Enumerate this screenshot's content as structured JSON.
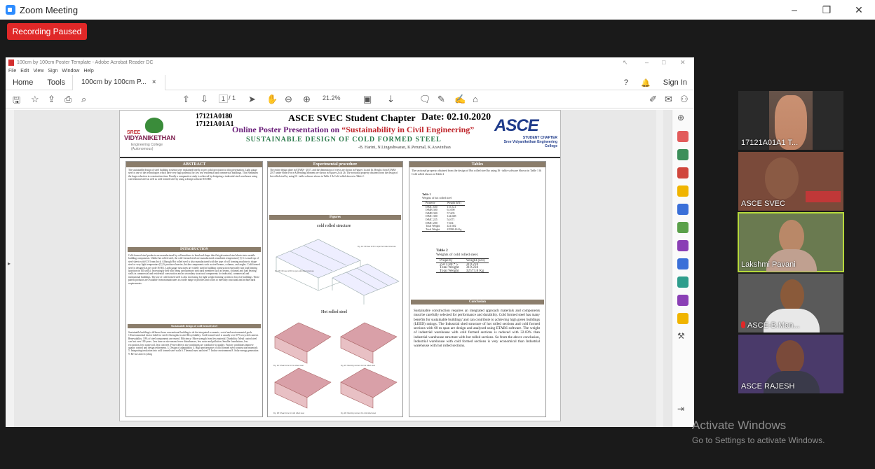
{
  "zoom": {
    "window_title": "Zoom Meeting",
    "recording_status": "Recording Paused",
    "controls": {
      "minimize": "–",
      "restore": "❐",
      "close": "✕"
    }
  },
  "acrobat": {
    "window_title": "100cm by 100cm Poster Template - Adobe Acrobat Reader DC",
    "menu": [
      "File",
      "Edit",
      "View",
      "Sign",
      "Window",
      "Help"
    ],
    "tabs": {
      "home": "Home",
      "tools": "Tools",
      "document": "100cm by 100cm P...",
      "close": "×"
    },
    "sign_in": "Sign In",
    "page_current": "1",
    "page_total": "/ 1",
    "zoom_level": "21.2%"
  },
  "poster": {
    "id1": "17121A0180",
    "id2": "17121A01A1",
    "chapter": "ASCE SVEC Student Chapter",
    "date": "Date: 02.10.2020",
    "presentation_prefix": "Online Poster Presentation on",
    "presentation_theme": "“Sustainability in Civil Engineering”",
    "design_title": "SUSTAINABLE DESIGN OF COLD FORMED STEEL",
    "authors": "-B. Harini, N.Lingeshwaran, K.Perumal, K.Aravinthan",
    "logo_left": {
      "line1": "SREE",
      "line2": "VIDYANIKETHAN",
      "line3": "Engineering College (Autonomous)"
    },
    "logo_right": {
      "big": "ASCE",
      "sub1": "STUDENT CHAPTER",
      "sub2": "Sree Vidyanikethan Engineering College"
    },
    "col1": {
      "abstract_h": "ABSTRACT",
      "abstract": "The sustainable design of steel building systems were explained briefly as per codal provisions in this presentation. Light gauge steel is one of the technologies which have very high potential for low rise residential and commercial buildings. This eliminates the huge reduction in construction time. Finally a comparative study is achieved by designing a industrial steel warehouse using conventional steel as well as cold formed steel by using a design software ETABS.",
      "intro_h": "INTRODUCTION",
      "intro": "Cold-formed steel products are manufactured by roll machines to bend and shape thin flat galvanized steel sheets into useable building components. Unlike hot rolled steel, the cold-formed steel are manufactured at ambient temperature [1]. It is made up of steel sheets with 0.3-3 mm thick. Although Hot rolled steel is also manufactured with the type of roll forming machine to shape steel or very light temperature [2]. It produces heavier, thicker components such as steel beams, columns, and angles. Cold formed steel is designed as per code IS 801. Light gauge structures are widely used in building construction especially non load bearing (partition in fill walls). Increasingly they also being used primary structural members such as beams, columns and load bearing walls in commercial and residential construction and as secondary structural components for industrial, commercial and institutional buildings. The use of cold formed steel is also increasing for light weight framing system in low rise buildings. These panels products are available from manufactures in a wide range of profiles and colors to meet any structural and architectural requirements.",
      "sust_h": "Sustainable design of cold formed steel",
      "sust": "Sustainable building is different from conventional building to do the integrated economic, social and environmental goals. 1.Environmental choice label for steel 2.Strengths in steel Recyclability: Cold formed steel is usually over 67% recycled content. Renewability: 10% of steel components are reused. Efficiency: More strength from less material. Durability: Metal coated steel can last over 100 years. Less time on site means fewer disturbances, less noise and pollution. Smaller foundations, less excavation, less waste soil, less concrete. Fewer defects site conditions are conducive to quality. Factory conditions improve quality control and design refinement. 3. Design of adaptability 4. High performance of cold formed steel construction materials 5. Integrating insulation into cold formed steel walls 6. Thermal mass and steel 7. Indoor environment 8. Solar energy generation 9. Re-use and recycling"
    },
    "col2": {
      "exp_h": "Experimental procedure",
      "exp": "The entire design done in ETABS - 2017, and the dimensions of views are shown in Figures 1a and 1b. Results from ETABS 2017 under Shear Force & Bending Moment are shown in Figures 2a & 2b. The sectional property obtained from the design of hot rolled steel by using IS - table software shown in Table 1 & Cold rolled shown in Table 2.",
      "fig_h": "Figures",
      "cold_title": "cold rolled structure",
      "hot_title": "Hot rolled steel",
      "cap1": "Fig. 1A: 3D view of 60 m span hot rolled structure",
      "cap2": "Fig. 1B: 3D view of 60 m span cold rolled structure",
      "cap3": "Fig. 2A: Shear force for hot rolled steel",
      "cap4": "Fig. 2C: Bending moment for hot rolled steel",
      "cap5": "Fig. 2B: Shear force for cold rolled steel",
      "cap6": "Fig. 2D: Bending moment for cold rolled steel"
    },
    "col3": {
      "tables_h": "Tables",
      "tables_intro": "The sectional property obtained from the design of Hot rolled steel by using IS - table software Shown in Table 1 & Cold rolled shown in Table 2",
      "t1_title": "Table 1",
      "t1_sub": "Weights of hot rolled steel",
      "t1_head": [
        "Property",
        "Weight (kN)"
      ],
      "t1_rows": [
        [
          "ISMC 600",
          "115.521"
        ],
        [
          "ISMB 300",
          "61.090"
        ],
        [
          "ISMB 300",
          "57.605"
        ],
        [
          "ISMC 300",
          "144.608"
        ],
        [
          "ISMC 225",
          "54.071"
        ],
        [
          "ISMC 200",
          "7.654"
        ],
        [
          "Total Weight",
          "421.602"
        ],
        [
          "Total Weight",
          "42998.46 Kg"
        ]
      ],
      "t2_title": "Table 2",
      "t2_sub": "Weights of cold rolled steel.",
      "t2_head": [
        "Property",
        "Weight (kN)"
      ],
      "t2_rows": [
        [
          "250 C80 * 5",
          "319.224"
        ],
        [
          "Total Weight",
          "319.224"
        ],
        [
          "Total Weight",
          "32573.8 Kg"
        ]
      ],
      "concl_h": "Conclusion",
      "concl": "Sustainable construction requires an integrated approach materials and components must be carefully selected for performance and durability. Cold formed steel has many benefits for sustainable buildings' and can contribute to achieving high green buildings (LEED) ratings. The Industrial shed structure of hot rolled sections and cold formed sections with 60 m span are design and analysed using ETABS software. The weight of industrial warehouse with cold formed sections is reduced with 32.03% than industrial warehouse structure with hot rolled sections. So from the above conclusion, Industrial warehouse with cold formed sections is very economical than Industrial warehouse with hot rolled sections."
    }
  },
  "participants": [
    {
      "name": "17121A01A1 T...",
      "muted": false
    },
    {
      "name": "ASCE SVEC",
      "muted": false
    },
    {
      "name": "Lakshmi Pavani",
      "muted": false
    },
    {
      "name": "ASCE-B.Man...",
      "muted": true
    },
    {
      "name": "ASCE RAJESH",
      "muted": false
    }
  ],
  "watermark": {
    "line1": "Activate Windows",
    "line2": "Go to Settings to activate Windows."
  },
  "colors": {
    "accent": "#2d8cff",
    "record": "#e02828",
    "active_speaker": "#b6d93b"
  }
}
